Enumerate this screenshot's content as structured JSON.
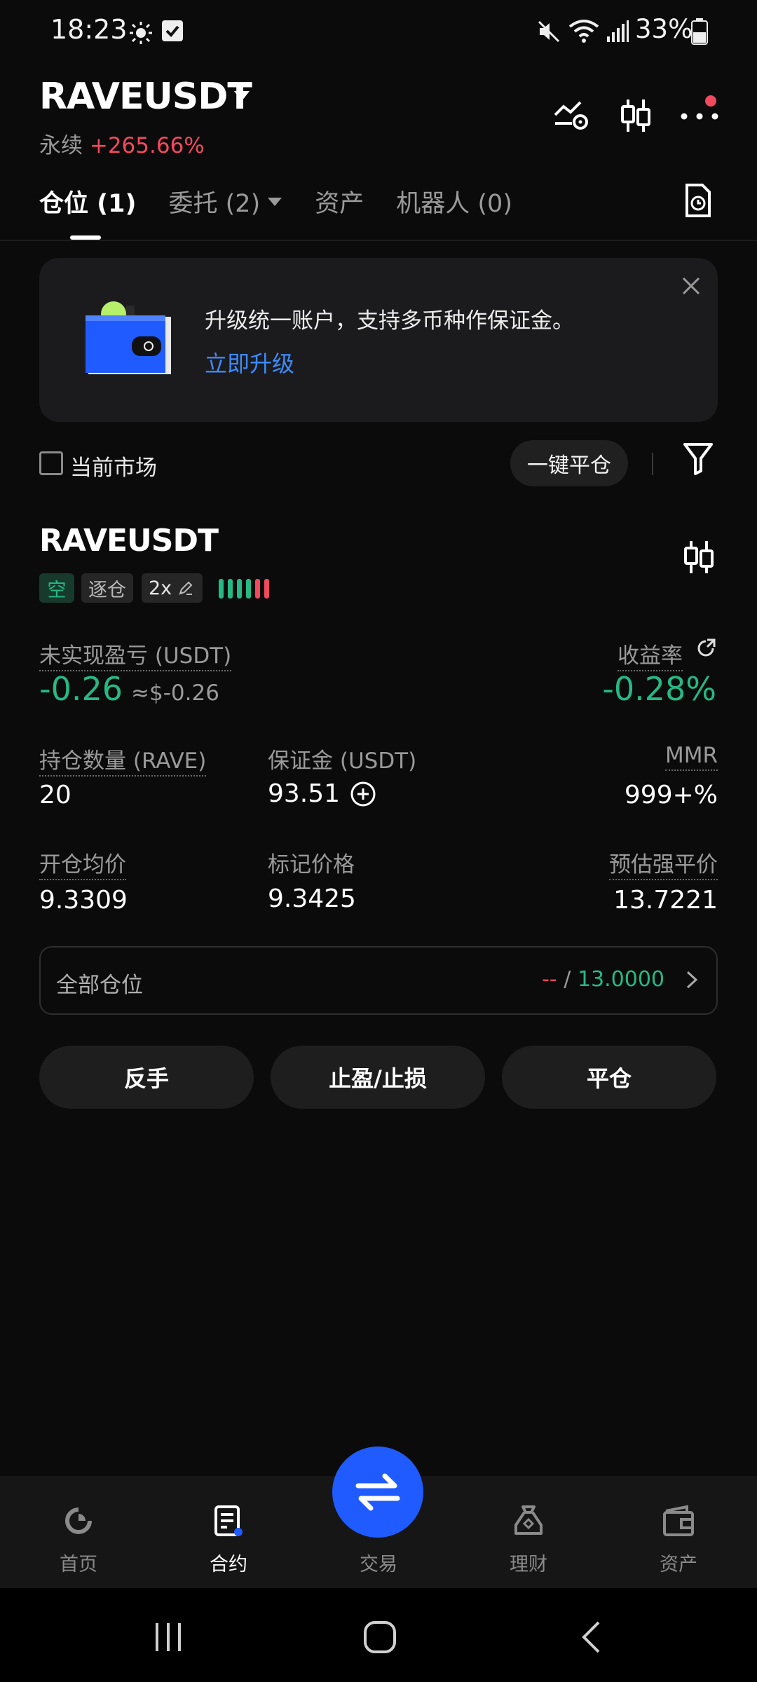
{
  "status_bar": {
    "time": "18:23",
    "battery": "33%"
  },
  "header": {
    "symbol": "RAVEUSDT",
    "type": "永续",
    "change": "+265.66%"
  },
  "tabs": [
    {
      "label": "仓位 (1)"
    },
    {
      "label": "委托 (2)"
    },
    {
      "label": "资产"
    },
    {
      "label": "机器人 (0)"
    }
  ],
  "banner": {
    "text": "升级统一账户，支持多币种作保证金。",
    "link": "立即升级"
  },
  "filter": {
    "current_market": "当前市场",
    "close_all": "一键平仓"
  },
  "position": {
    "symbol": "RAVEUSDT",
    "tags": {
      "side": "空",
      "margin_mode": "逐仓",
      "leverage": "2x"
    },
    "unrealized_label": "未实现盈亏 (USDT)",
    "unrealized_value": "-0.26",
    "unrealized_usd": "≈$-0.26",
    "roi_label": "收益率",
    "roi_value": "-0.28%",
    "size_label": "持仓数量 (RAVE)",
    "size_value": "20",
    "margin_label": "保证金 (USDT)",
    "margin_value": "93.51",
    "mmr_label": "MMR",
    "mmr_value": "999+%",
    "entry_label": "开仓均价",
    "entry_value": "9.3309",
    "mark_label": "标记价格",
    "mark_value": "9.3425",
    "liq_label": "预估强平价",
    "liq_value": "13.7221",
    "total_label": "全部仓位",
    "total_tp": "--",
    "total_sep": "/",
    "total_sl": "13.0000"
  },
  "actions": {
    "reverse": "反手",
    "tpsl": "止盈/止损",
    "close": "平仓"
  },
  "bottom_nav": [
    {
      "label": "首页"
    },
    {
      "label": "合约"
    },
    {
      "label": "交易"
    },
    {
      "label": "理财"
    },
    {
      "label": "资产"
    }
  ],
  "colors": {
    "green": "#25b985",
    "red": "#f2495e",
    "orange": "#f5a56b",
    "accent_blue": "#1f5bff",
    "link_blue": "#3d8bff"
  }
}
